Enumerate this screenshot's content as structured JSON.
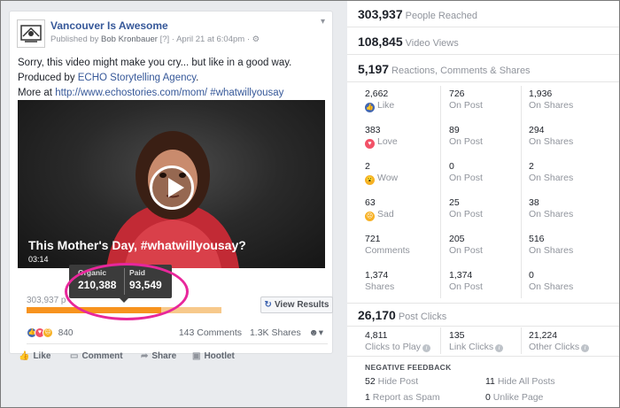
{
  "post": {
    "page_name": "Vancouver Is Awesome",
    "published_by": "Published by",
    "author": "Bob Kronbauer",
    "meta_tail": "[?] · April 21 at 6:04pm · ⚙",
    "text_line1": "Sorry, this video might make you cry... but like in a good way.",
    "text_line2_prefix": "Produced by ",
    "text_line2_link": "ECHO Storytelling Agency",
    "text_line2_suffix": ".",
    "text_line3_prefix": "More at ",
    "text_line3_link": "http://www.echostories.com/mom/ #whatwillyousay",
    "video_title": "This Mother's Day, #whatwillyousay?",
    "video_time": "03:14",
    "tooltip": {
      "organic_label": "Organic",
      "organic_value": "210,388",
      "paid_label": "Paid",
      "paid_value": "93,549"
    },
    "reach_text": "303,937 p",
    "reach_organic_fraction": 0.69,
    "view_results": "View Results",
    "reaction_count": "840",
    "comments": "143 Comments",
    "shares": "1.3K Shares",
    "actions": {
      "like": "Like",
      "comment": "Comment",
      "share": "Share",
      "hootlet": "Hootlet"
    }
  },
  "insights": {
    "people_reached": {
      "value": "303,937",
      "label": "People Reached"
    },
    "video_views": {
      "value": "108,845",
      "label": "Video Views"
    },
    "rcs": {
      "value": "5,197",
      "label": "Reactions, Comments & Shares"
    },
    "grid": [
      {
        "total": "2,662",
        "label": "Like",
        "on_post": "726",
        "on_shares": "1,936",
        "icon": "like-icon",
        "color": "#4267b2"
      },
      {
        "total": "383",
        "label": "Love",
        "on_post": "89",
        "on_shares": "294",
        "icon": "love-icon",
        "color": "#f25268"
      },
      {
        "total": "2",
        "label": "Wow",
        "on_post": "0",
        "on_shares": "2",
        "icon": "wow-icon",
        "color": "#f7b125"
      },
      {
        "total": "63",
        "label": "Sad",
        "on_post": "25",
        "on_shares": "38",
        "icon": "sad-icon",
        "color": "#f7b125"
      },
      {
        "total": "721",
        "label": "Comments",
        "on_post": "205",
        "on_shares": "516"
      },
      {
        "total": "1,374",
        "label": "Shares",
        "on_post": "1,374",
        "on_shares": "0"
      }
    ],
    "on_post_label": "On Post",
    "on_shares_label": "On Shares",
    "post_clicks": {
      "value": "26,170",
      "label": "Post Clicks"
    },
    "clicks": [
      {
        "value": "4,811",
        "label": "Clicks to Play"
      },
      {
        "value": "135",
        "label": "Link Clicks"
      },
      {
        "value": "21,224",
        "label": "Other Clicks"
      }
    ],
    "negative_title": "NEGATIVE FEEDBACK",
    "negative": [
      {
        "value": "52",
        "label": "Hide Post"
      },
      {
        "value": "11",
        "label": "Hide All Posts"
      },
      {
        "value": "1",
        "label": "Report as Spam"
      },
      {
        "value": "0",
        "label": "Unlike Page"
      }
    ]
  },
  "colors": {
    "accent": "#e8279b",
    "link": "#365899",
    "paid_bar": "#f7931e"
  }
}
